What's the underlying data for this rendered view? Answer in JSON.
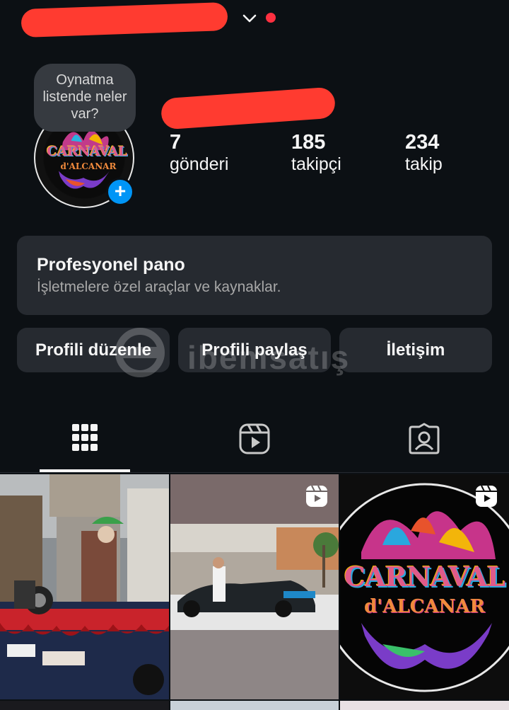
{
  "profile": {
    "note_text": "Oynatma listende neler var?",
    "avatar_logo_title": "CARNAVAL",
    "avatar_logo_subtitle": "d'ALCANAR"
  },
  "stats": [
    {
      "value": "7",
      "label": "gönderi"
    },
    {
      "value": "185",
      "label": "takipçi"
    },
    {
      "value": "234",
      "label": "takip"
    }
  ],
  "pro_dashboard": {
    "title": "Profesyonel pano",
    "subtitle": "İşletmelere özel araçlar ve kaynaklar."
  },
  "buttons": {
    "edit_profile": "Profili düzenle",
    "share_profile": "Profili paylaş",
    "contact": "İletişim"
  },
  "watermark": {
    "text": "ibemsatış"
  },
  "tabs": [
    {
      "icon": "grid-icon",
      "active": true
    },
    {
      "icon": "reels-icon",
      "active": false
    },
    {
      "icon": "tagged-icon",
      "active": false
    }
  ],
  "grid_posts": [
    {
      "type": "photo",
      "subject": "carnival car with costumed man"
    },
    {
      "type": "reel",
      "subject": "carnival car on street"
    },
    {
      "type": "reel",
      "subject": "CARNAVAL d'ALCANAR logo",
      "logo_title": "CARNAVAL",
      "logo_subtitle": "d'ALCANAR"
    }
  ],
  "colors": {
    "background": "#0c1014",
    "card": "#262a30",
    "accent_blue": "#0095f6",
    "notification_red": "#ff3040",
    "redaction_red": "#ff3b30"
  }
}
